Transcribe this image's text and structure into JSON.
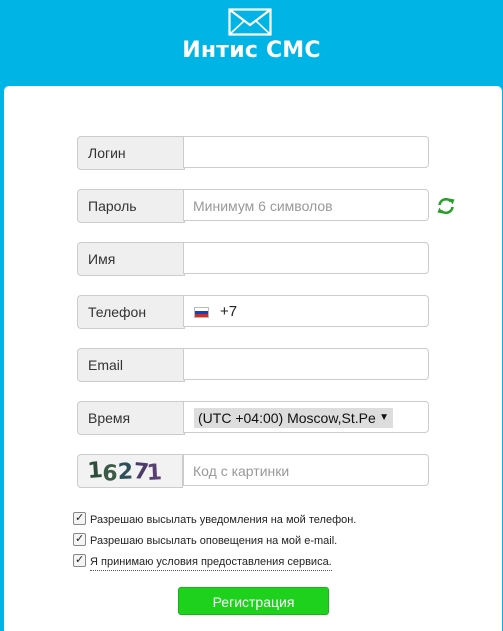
{
  "header": {
    "title": "Интис СМС",
    "logo_icon": "envelope-icon"
  },
  "form": {
    "login": {
      "label": "Логин",
      "value": ""
    },
    "password": {
      "label": "Пароль",
      "placeholder": "Минимум 6 символов",
      "refresh_icon": "refresh-icon"
    },
    "name": {
      "label": "Имя",
      "value": ""
    },
    "phone": {
      "label": "Телефон",
      "country_flag": "russia-flag-icon",
      "code": "+7"
    },
    "email": {
      "label": "Email",
      "value": ""
    },
    "timezone": {
      "label": "Время",
      "selected": "(UTC +04:00) Moscow,St.Pe"
    },
    "captcha": {
      "image_text": "16271",
      "placeholder": "Код с картинки"
    }
  },
  "checkboxes": [
    {
      "label": "Разрешаю высылать уведомления на мой телефон.",
      "checked": true
    },
    {
      "label": "Разрешаю высылать оповещения на мой e-mail.",
      "checked": true
    },
    {
      "label": "Я принимаю условия предоставления сервиса.",
      "checked": true
    }
  ],
  "submit": {
    "label": "Регистрация"
  },
  "colors": {
    "header_bg": "#00b4e6",
    "button_bg": "#1dd11d",
    "refresh_icon": "#2a9d2a"
  }
}
